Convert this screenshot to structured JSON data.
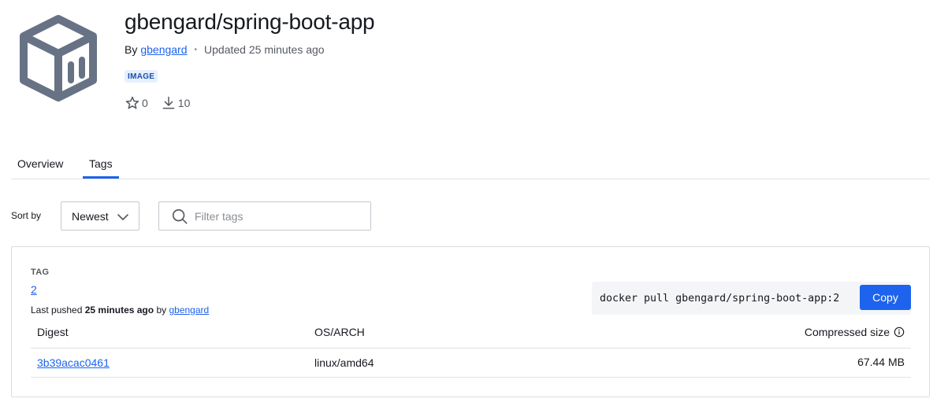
{
  "repo": {
    "title": "gbengard/spring-boot-app",
    "by_label": "By",
    "owner": "gbengard",
    "dot": "•",
    "updated": "Updated 25 minutes ago",
    "badge": "IMAGE",
    "stars": "0",
    "pulls": "10"
  },
  "tabs": [
    {
      "label": "Overview",
      "active": false
    },
    {
      "label": "Tags",
      "active": true
    }
  ],
  "controls": {
    "sort_label": "Sort by",
    "sort_value": "Newest",
    "filter_placeholder": "Filter tags"
  },
  "tag_card": {
    "tag_label": "TAG",
    "tag_value": "2",
    "pushed_prefix": "Last pushed",
    "pushed_time": "25 minutes ago",
    "pushed_by": "by",
    "pushed_user": "gbengard",
    "pull_command": "docker pull gbengard/spring-boot-app:2",
    "copy_label": "Copy",
    "columns": {
      "digest": "Digest",
      "os_arch": "OS/ARCH",
      "size": "Compressed size"
    },
    "rows": [
      {
        "digest": "3b39acac0461",
        "os_arch": "linux/amd64",
        "size": "67.44 MB"
      }
    ]
  },
  "colors": {
    "accent": "#1d63ed",
    "logo": "#677285"
  },
  "icons": {
    "logo": "docker-image-cube-icon",
    "star": "star-icon",
    "download": "download-icon",
    "chevron": "chevron-down-icon",
    "search": "search-icon",
    "info": "info-icon"
  }
}
